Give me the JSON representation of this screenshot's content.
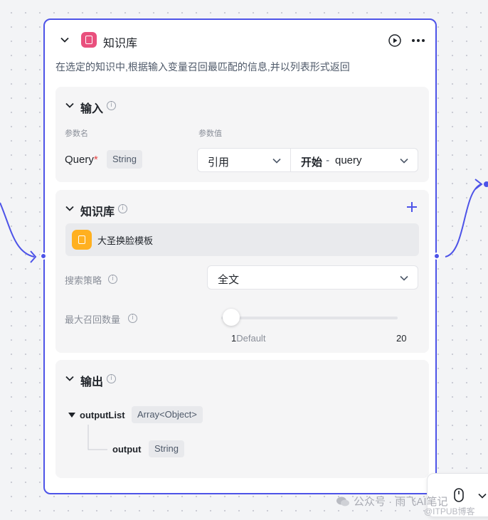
{
  "node": {
    "title": "知识库",
    "description": "在选定的知识中,根据输入变量召回最匹配的信息,并以列表形式返回",
    "run_icon": "play-circle-icon",
    "more_icon": "more-dots-icon",
    "accent": "#4d53e8"
  },
  "input": {
    "title": "输入",
    "col_name": "参数名",
    "col_value": "参数值",
    "param_name": "Query",
    "required_mark": "*",
    "param_type": "String",
    "ref_mode": "引用",
    "ref_value_source": "开始",
    "ref_value_sep": " - ",
    "ref_value_field": "query"
  },
  "knowledge": {
    "title": "知识库",
    "add_icon": "plus-icon",
    "item_name": "大圣换脸模板",
    "strategy_label": "搜索策略",
    "strategy_value": "全文",
    "max_label": "最大召回数量",
    "slider_min": "1",
    "slider_default": "Default",
    "slider_max": "20",
    "slider_value": 1
  },
  "output": {
    "title": "输出",
    "list_name": "outputList",
    "list_type": "Array<Object>",
    "child_name": "output",
    "child_type": "String"
  },
  "watermark": {
    "text1": "公众号 · 雨飞AI笔记",
    "text2": "@ITPUB博客"
  }
}
